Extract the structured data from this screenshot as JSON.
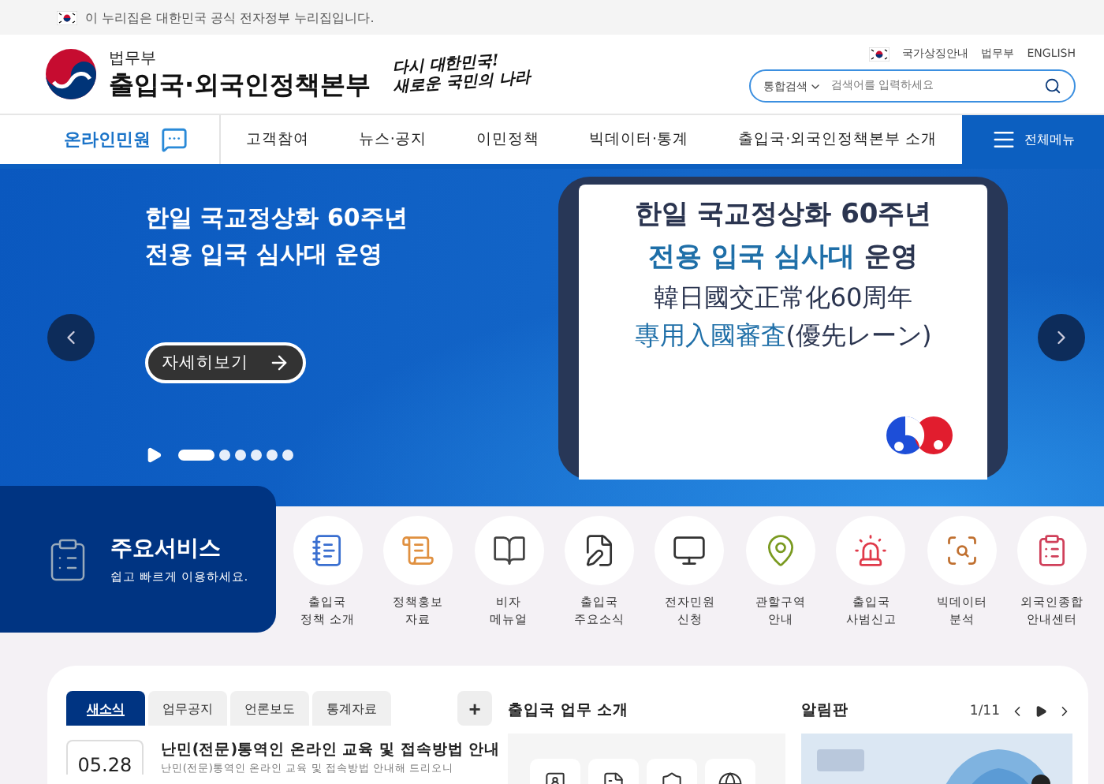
{
  "gov_banner": {
    "text": "이 누리집은 대한민국 공식 전자정부 누리집입니다."
  },
  "header": {
    "org": "법무부",
    "title": "출입국·외국인정책본부",
    "slogan_lines": [
      "다시 대한민국!",
      "새로운 국민의 나라"
    ],
    "util_links": [
      "국가상징안내",
      "법무부",
      "ENGLISH"
    ],
    "search": {
      "scope": "통합검색",
      "placeholder": "검색어를 입력하세요"
    }
  },
  "nav": {
    "items": [
      {
        "label": "온라인민원",
        "kind": "featured"
      },
      {
        "label": "고객참여",
        "kind": "plain"
      },
      {
        "label": "뉴스·공지",
        "kind": "plain"
      },
      {
        "label": "이민정책",
        "kind": "plain"
      },
      {
        "label": "빅데이터·통계",
        "kind": "plain"
      },
      {
        "label": "출입국·외국인정책본부 소개",
        "kind": "plain"
      }
    ],
    "all_menu": "전체메뉴"
  },
  "hero": {
    "headline": [
      "한일 국교정상화 60주년",
      "전용 입국 심사대 운영"
    ],
    "more_button": "자세히보기",
    "playing": false,
    "slides": [
      {
        "selected": true
      },
      {
        "selected": false
      },
      {
        "selected": false
      },
      {
        "selected": false
      },
      {
        "selected": false
      },
      {
        "selected": false
      }
    ],
    "card": {
      "lines": [
        {
          "kind": "heading",
          "segments": [
            {
              "text": "한일 국교정상화 60주년",
              "color": "#2b3550"
            }
          ]
        },
        {
          "kind": "heading",
          "segments": [
            {
              "text": "전용 입국 심사대",
              "color": "#1f6fa8"
            },
            {
              "text": " 운영",
              "color": "#2b3550"
            }
          ]
        },
        {
          "kind": "hanja",
          "segments": [
            {
              "text": "韓日國交正常化60周年",
              "color": "#2b3550"
            }
          ]
        },
        {
          "kind": "hanja",
          "segments": [
            {
              "text": "專用入國審査",
              "color": "#1f6fa8"
            },
            {
              "text": "(優先レーン)",
              "color": "#2b3550"
            }
          ]
        }
      ]
    }
  },
  "services": {
    "title": "주요서비스",
    "subtitle": "쉽고 빠르게 이용하세요.",
    "items": [
      {
        "kind": "notebook",
        "lines": [
          "출입국",
          "정책 소개"
        ]
      },
      {
        "kind": "scroll",
        "lines": [
          "정책홍보",
          "자료"
        ]
      },
      {
        "kind": "book",
        "lines": [
          "비자",
          "메뉴얼"
        ]
      },
      {
        "kind": "pen",
        "lines": [
          "출입국",
          "주요소식"
        ]
      },
      {
        "kind": "monitor",
        "lines": [
          "전자민원",
          "신청"
        ]
      },
      {
        "kind": "map",
        "lines": [
          "관할구역",
          "안내"
        ]
      },
      {
        "kind": "siren",
        "lines": [
          "출입국",
          "사범신고"
        ]
      },
      {
        "kind": "analysis",
        "lines": [
          "빅데이터",
          "분석"
        ]
      },
      {
        "kind": "checklist",
        "lines": [
          "외국인종합",
          "안내센터"
        ]
      }
    ]
  },
  "news": {
    "tabs": [
      {
        "label": "새소식",
        "selected": true
      },
      {
        "label": "업무공지",
        "selected": false
      },
      {
        "label": "언론보도",
        "selected": false
      },
      {
        "label": "통계자료",
        "selected": false
      }
    ],
    "more": "+",
    "items": [
      {
        "date": "05.28",
        "title": "난민(전문)통역인 온라인 교육 및 접속방법 안내",
        "summary": "난민(전문)통역인 온라인 교육 및 접속방법 안내해 드리오니"
      }
    ]
  },
  "intro": {
    "title": "출입국 업무 소개",
    "tiles": [
      {
        "kind": "passport"
      },
      {
        "kind": "document"
      },
      {
        "kind": "shield"
      },
      {
        "kind": "globe"
      }
    ]
  },
  "board": {
    "title": "알림판",
    "counter": "1/11",
    "playing": false
  }
}
